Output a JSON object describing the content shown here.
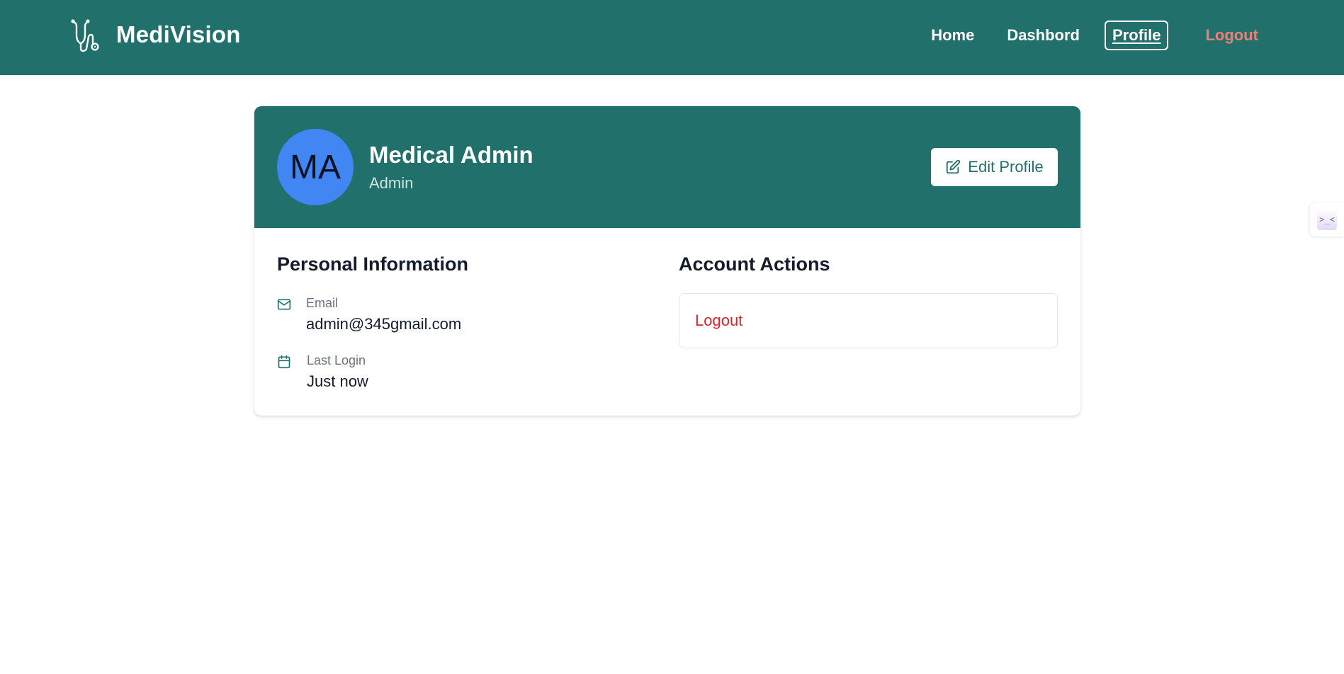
{
  "navbar": {
    "brand": "MediVision",
    "links": [
      {
        "label": "Home"
      },
      {
        "label": "Dashbord"
      },
      {
        "label": "Profile"
      },
      {
        "label": "Logout"
      }
    ]
  },
  "profile": {
    "avatar_initials": "MA",
    "name": "Medical Admin",
    "role": "Admin",
    "edit_button": "Edit Profile"
  },
  "personal_info": {
    "title": "Personal Information",
    "email_label": "Email",
    "email_value": "admin@345gmail.com",
    "last_login_label": "Last Login",
    "last_login_value": "Just now"
  },
  "account_actions": {
    "title": "Account Actions",
    "logout_label": "Logout"
  },
  "side_widget": {
    "glyph": ">_<"
  },
  "colors": {
    "primary": "#21706b",
    "avatar_bg": "#4286f4",
    "logout_nav": "#f07e77",
    "logout_action": "#d3262c"
  }
}
